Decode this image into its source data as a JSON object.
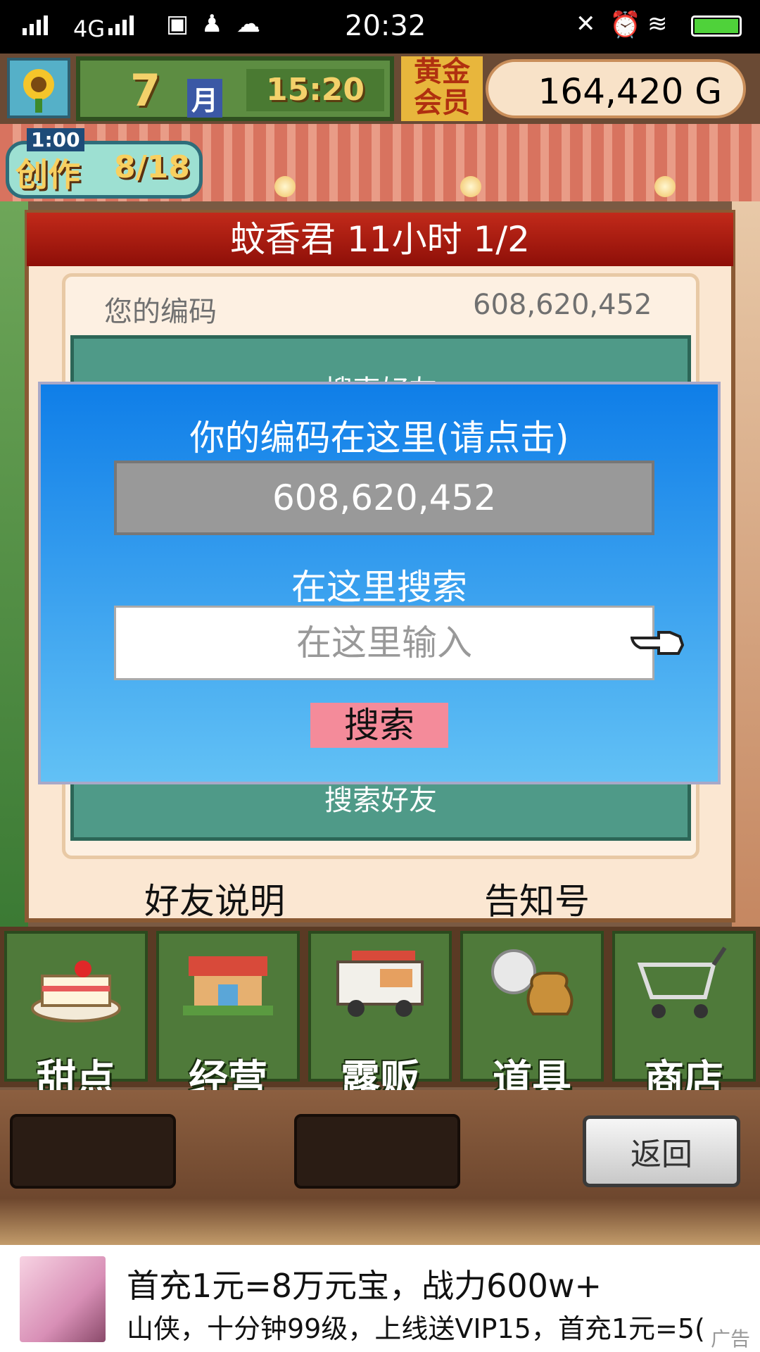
{
  "status_bar": {
    "network": "4G",
    "time": "20:32",
    "apps": [
      "du-icon",
      "qq-icon",
      "wechat-icon"
    ],
    "system": [
      "mute-icon",
      "alarm-icon",
      "wifi-icon",
      "battery-icon"
    ]
  },
  "hud": {
    "month": "7",
    "month_unit": "月",
    "clock": "15:20",
    "membership": "黄金会员",
    "money": "164,420 G"
  },
  "create_badge": {
    "label": "创作",
    "timer": "1:00",
    "count": "8/18"
  },
  "panel": {
    "title": "蚊香君  11小时 1/2",
    "code_label": "您的编码",
    "code_value": "608,620,452",
    "hidden_top_text": "搜索好友",
    "search_friend": "搜索好友",
    "friend_info": "好友说明",
    "notice": "告知号"
  },
  "dialog": {
    "title": "你的编码在这里(请点击)",
    "code": "608,620,452",
    "search_label": "在这里搜索",
    "search_placeholder": "在这里输入",
    "search_button": "搜索"
  },
  "menu": {
    "items": [
      {
        "label": "甜点",
        "icon": "cake-icon"
      },
      {
        "label": "经营",
        "icon": "shop-icon"
      },
      {
        "label": "露贩",
        "icon": "food-truck-icon"
      },
      {
        "label": "道具",
        "icon": "items-bag-icon"
      },
      {
        "label": "商店",
        "icon": "cart-icon"
      }
    ]
  },
  "bottom": {
    "back_button": "返回"
  },
  "ad": {
    "line1": "首充1元=8万元宝，战力600w+",
    "line2": "山侠，十分钟99级，上线送VIP15，首充1元=5(",
    "tag": "广告"
  }
}
